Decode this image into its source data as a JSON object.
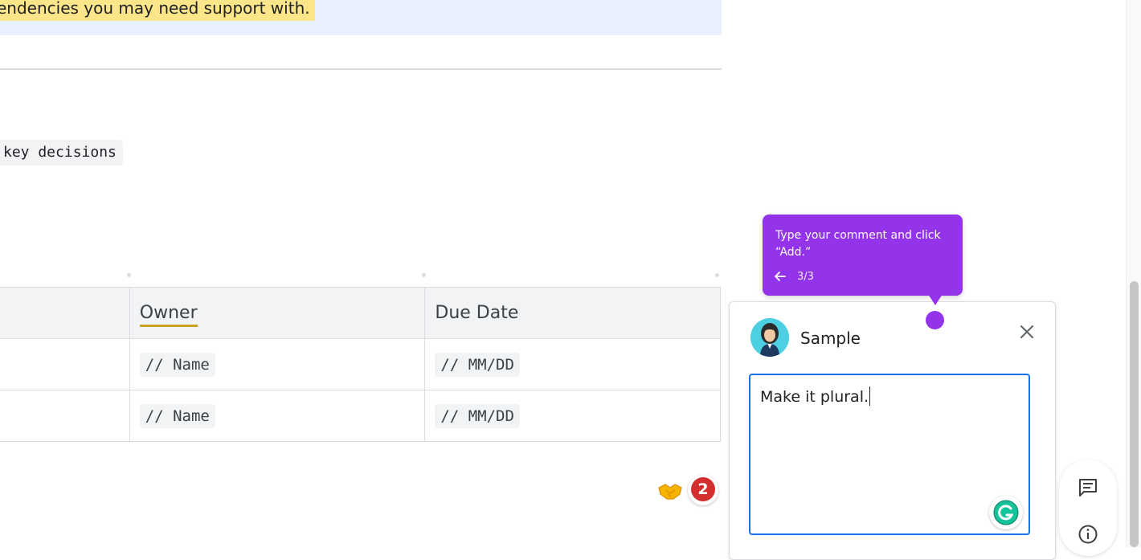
{
  "document": {
    "callout_text": "endencies you may need support with.",
    "code_text": "key decisions",
    "table": {
      "headers": [
        "",
        "Owner",
        "Due Date"
      ],
      "rows": [
        [
          "",
          "// Name",
          "// MM/DD"
        ],
        [
          "",
          "// Name",
          "// MM/DD"
        ]
      ]
    },
    "reactions": {
      "emoji_icon": "handshake-icon",
      "badge_count": "2"
    }
  },
  "comment": {
    "user_name": "Sample",
    "input_value": "Make it plural.",
    "close_icon": "close-icon"
  },
  "tooltip": {
    "text": "Type your comment and click “Add.”",
    "step": "3/3"
  },
  "colors": {
    "accent_purple": "#9333ea",
    "input_border": "#1a73e8",
    "highlight_yellow": "#fde68a",
    "badge_red": "#d32f2f"
  }
}
